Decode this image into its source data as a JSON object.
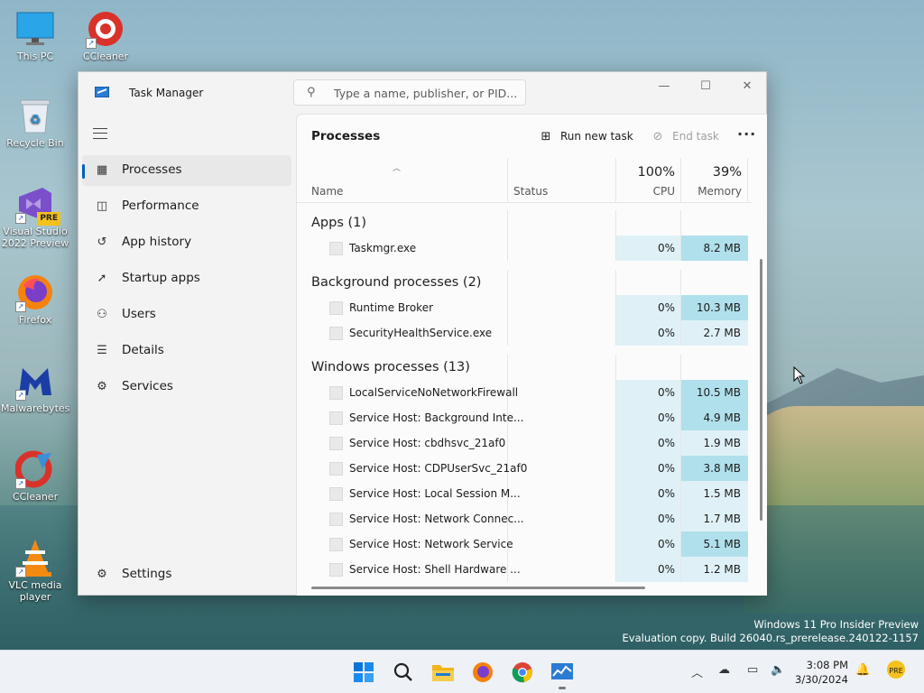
{
  "desktop": {
    "icons": [
      {
        "label": "This PC",
        "icon": "monitor-icon"
      },
      {
        "label": "CCleaner",
        "icon": "ccleaner-icon"
      },
      {
        "label": "Recycle Bin",
        "icon": "recycle-bin-icon"
      },
      {
        "label": "Visual Studio 2022 Preview",
        "icon": "visual-studio-icon",
        "badge": "PRE"
      },
      {
        "label": "Firefox",
        "icon": "firefox-icon"
      },
      {
        "label": "Malwarebytes",
        "icon": "malwarebytes-icon"
      },
      {
        "label": "CCleaner",
        "icon": "ccleaner-icon"
      },
      {
        "label": "VLC media player",
        "icon": "vlc-icon"
      }
    ],
    "watermark": {
      "line1": "Windows 11 Pro Insider Preview",
      "line2": "Evaluation copy. Build 26040.rs_prerelease.240122-1157"
    }
  },
  "window": {
    "title": "Task Manager",
    "search_placeholder": "Type a name, publisher, or PID...",
    "controls": {
      "minimize": "—",
      "maximize": "☐",
      "close": "✕"
    }
  },
  "nav": {
    "items": [
      {
        "label": "Processes",
        "icon": "processes-icon",
        "active": true
      },
      {
        "label": "Performance",
        "icon": "performance-icon"
      },
      {
        "label": "App history",
        "icon": "app-history-icon"
      },
      {
        "label": "Startup apps",
        "icon": "startup-apps-icon"
      },
      {
        "label": "Users",
        "icon": "users-icon"
      },
      {
        "label": "Details",
        "icon": "details-icon"
      },
      {
        "label": "Services",
        "icon": "services-icon"
      }
    ],
    "settings_label": "Settings"
  },
  "page": {
    "title": "Processes",
    "run_new_task": "Run new task",
    "end_task": "End task",
    "more": "···"
  },
  "columns": {
    "name": "Name",
    "status": "Status",
    "cpu": {
      "pct": "100%",
      "label": "CPU"
    },
    "memory": {
      "pct": "39%",
      "label": "Memory"
    }
  },
  "groups": [
    {
      "label": "Apps (1)",
      "processes": [
        {
          "name": "Taskmgr.exe",
          "cpu": "0%",
          "memory": "8.2 MB"
        }
      ]
    },
    {
      "label": "Background processes (2)",
      "processes": [
        {
          "name": "Runtime Broker",
          "cpu": "0%",
          "memory": "10.3 MB"
        },
        {
          "name": "SecurityHealthService.exe",
          "cpu": "0%",
          "memory": "2.7 MB"
        }
      ]
    },
    {
      "label": "Windows processes (13)",
      "processes": [
        {
          "name": "LocalServiceNoNetworkFirewall",
          "cpu": "0%",
          "memory": "10.5 MB"
        },
        {
          "name": "Service Host: Background Inte...",
          "cpu": "0%",
          "memory": "4.9 MB"
        },
        {
          "name": "Service Host: cbdhsvc_21af0",
          "cpu": "0%",
          "memory": "1.9 MB"
        },
        {
          "name": "Service Host: CDPUserSvc_21af0",
          "cpu": "0%",
          "memory": "3.8 MB"
        },
        {
          "name": "Service Host: Local Session M...",
          "cpu": "0%",
          "memory": "1.5 MB"
        },
        {
          "name": "Service Host: Network Connec...",
          "cpu": "0%",
          "memory": "1.7 MB"
        },
        {
          "name": "Service Host: Network Service",
          "cpu": "0%",
          "memory": "5.1 MB"
        },
        {
          "name": "Service Host: Shell Hardware ...",
          "cpu": "0%",
          "memory": "1.2 MB"
        }
      ]
    }
  ],
  "taskbar": {
    "apps": [
      "start-icon",
      "search-icon",
      "file-explorer-icon",
      "firefox-icon",
      "chrome-icon",
      "task-manager-icon"
    ],
    "clock": {
      "time": "3:08 PM",
      "date": "3/30/2024"
    }
  },
  "colors": {
    "accent": "#005fb8",
    "cpu_cell": "#dff1f7",
    "memory_light": "#dff1f7",
    "memory_mid": "#c7e8f2",
    "memory_strong": "#b0e0ec"
  }
}
